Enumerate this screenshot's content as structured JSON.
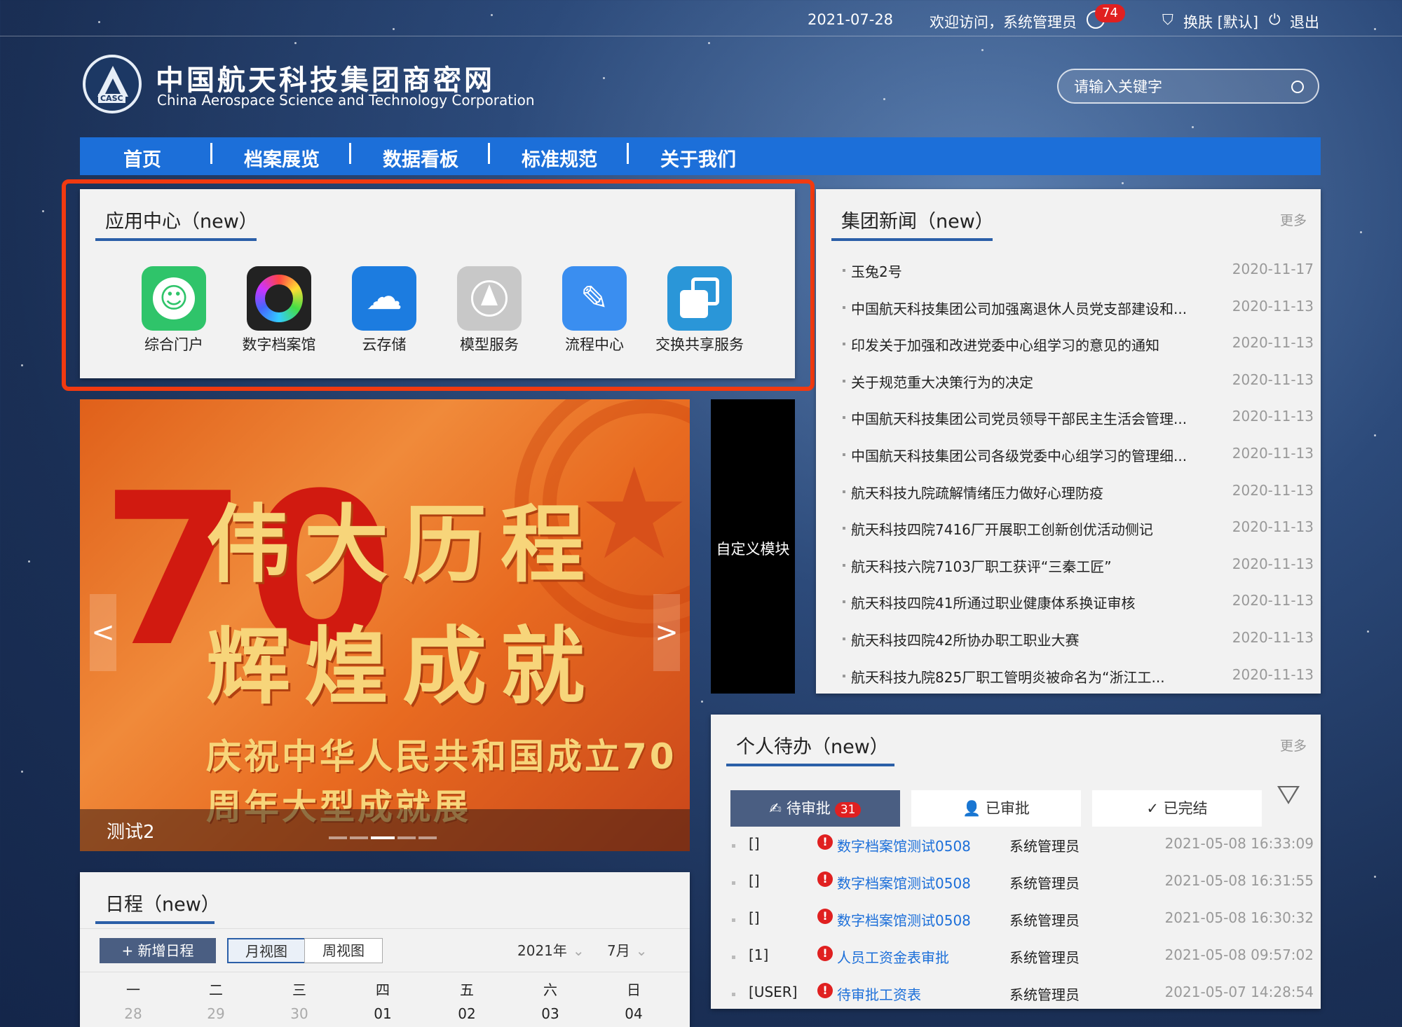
{
  "topbar": {
    "date": "2021-07-28",
    "welcome": "欢迎访问，系统管理员",
    "notifications": "74",
    "skin": "换肤 [默认]",
    "logout": "退出"
  },
  "header": {
    "logo_text": "CASC",
    "title_cn": "中国航天科技集团商密网",
    "title_en": "China Aerospace Science and Technology Corporation",
    "search_placeholder": "请输入关键字"
  },
  "nav": [
    "首页",
    "档案展览",
    "数据看板",
    "标准规范",
    "关于我们"
  ],
  "apps": {
    "title": "应用中心（new）",
    "items": [
      {
        "label": "综合门户",
        "color": "#2fc46a"
      },
      {
        "label": "数字档案馆",
        "color": "#222222"
      },
      {
        "label": "云存储",
        "color": "#1c7ce0"
      },
      {
        "label": "模型服务",
        "color": "#c8c8c8"
      },
      {
        "label": "流程中心",
        "color": "#3a8ef0"
      },
      {
        "label": "交换共享服务",
        "color": "#2a96d8"
      }
    ]
  },
  "banner": {
    "headline": "伟大历程 辉煌成就",
    "subline": "庆祝中华人民共和国成立70周年大型成就展",
    "numeral": "70",
    "caption": "测试2",
    "prev": "<",
    "next": ">"
  },
  "custom_module": "自定义模块",
  "news": {
    "title": "集团新闻（new）",
    "more": "更多",
    "items": [
      {
        "title": "玉兔2号",
        "date": "2020-11-17"
      },
      {
        "title": "中国航天科技集团公司加强离退休人员党支部建设和...",
        "date": "2020-11-13"
      },
      {
        "title": "印发关于加强和改进党委中心组学习的意见的通知",
        "date": "2020-11-13"
      },
      {
        "title": "关于规范重大决策行为的决定",
        "date": "2020-11-13"
      },
      {
        "title": "中国航天科技集团公司党员领导干部民主生活会管理...",
        "date": "2020-11-13"
      },
      {
        "title": "中国航天科技集团公司各级党委中心组学习的管理细...",
        "date": "2020-11-13"
      },
      {
        "title": "航天科技九院疏解情绪压力做好心理防疫",
        "date": "2020-11-13"
      },
      {
        "title": "航天科技四院7416厂开展职工创新创优活动侧记",
        "date": "2020-11-13"
      },
      {
        "title": "航天科技六院7103厂职工获评“三秦工匠”",
        "date": "2020-11-13"
      },
      {
        "title": "航天科技四院41所通过职业健康体系换证审核",
        "date": "2020-11-13"
      },
      {
        "title": "航天科技四院42所协办职工职业大赛",
        "date": "2020-11-13"
      },
      {
        "title": "航天科技九院825厂职工管明炎被命名为“浙江工...",
        "date": "2020-11-13"
      }
    ]
  },
  "todo": {
    "title": "个人待办（new）",
    "more": "更多",
    "tabs": [
      {
        "label": "待审批",
        "count": "31"
      },
      {
        "label": "已审批"
      },
      {
        "label": "已完结"
      }
    ],
    "rows": [
      {
        "tag": "[]",
        "title": "数字档案馆测试0508",
        "user": "系统管理员",
        "time": "2021-05-08 16:33:09"
      },
      {
        "tag": "[]",
        "title": "数字档案馆测试0508",
        "user": "系统管理员",
        "time": "2021-05-08 16:31:55"
      },
      {
        "tag": "[]",
        "title": "数字档案馆测试0508",
        "user": "系统管理员",
        "time": "2021-05-08 16:30:32"
      },
      {
        "tag": "[1]",
        "title": "人员工资金表审批",
        "user": "系统管理员",
        "time": "2021-05-08 09:57:02"
      },
      {
        "tag": "[USER]",
        "title": "待审批工资表",
        "user": "系统管理员",
        "time": "2021-05-07 14:28:54"
      }
    ]
  },
  "calendar": {
    "title": "日程（new）",
    "add_button": "+ 新增日程",
    "month_view": "月视图",
    "week_view": "周视图",
    "year": "2021年",
    "month": "7月",
    "weekdays": [
      "一",
      "二",
      "三",
      "四",
      "五",
      "六",
      "日"
    ],
    "days": [
      {
        "d": "28",
        "muted": true
      },
      {
        "d": "29",
        "muted": true
      },
      {
        "d": "30",
        "muted": true
      },
      {
        "d": "01",
        "muted": false
      },
      {
        "d": "02",
        "muted": false
      },
      {
        "d": "03",
        "muted": false
      },
      {
        "d": "04",
        "muted": false
      }
    ]
  }
}
